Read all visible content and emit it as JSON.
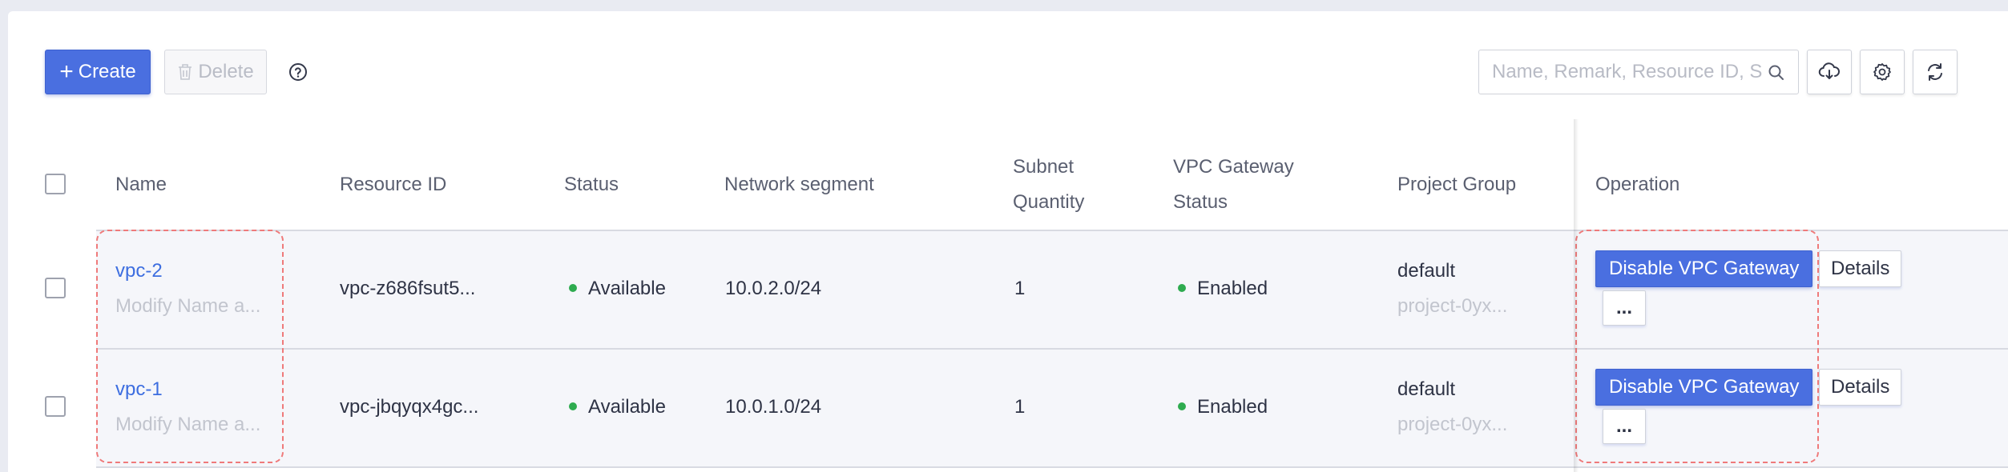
{
  "toolbar": {
    "create_label": "Create",
    "delete_label": "Delete",
    "search_placeholder": "Name, Remark, Resource ID, S"
  },
  "table": {
    "headers": {
      "name": "Name",
      "resource_id": "Resource ID",
      "status": "Status",
      "network_segment": "Network segment",
      "subnet_quantity_line1": "Subnet",
      "subnet_quantity_line2": "Quantity",
      "vpc_gateway_status_line1": "VPC Gateway",
      "vpc_gateway_status_line2": "Status",
      "project_group": "Project Group",
      "operation": "Operation"
    },
    "rows": [
      {
        "name": "vpc-2",
        "remark": "Modify Name a...",
        "resource_id": "vpc-z686fsut5...",
        "status": "Available",
        "network_segment": "10.0.2.0/24",
        "subnet_quantity": "1",
        "vpc_gateway_status": "Enabled",
        "project_group": "default",
        "project_id": "project-0yx...",
        "op_primary": "Disable VPC Gateway",
        "op_details": "Details",
        "op_more": "..."
      },
      {
        "name": "vpc-1",
        "remark": "Modify Name a...",
        "resource_id": "vpc-jbqyqx4gc...",
        "status": "Available",
        "network_segment": "10.0.1.0/24",
        "subnet_quantity": "1",
        "vpc_gateway_status": "Enabled",
        "project_group": "default",
        "project_id": "project-0yx...",
        "op_primary": "Disable VPC Gateway",
        "op_details": "Details",
        "op_more": "..."
      }
    ]
  },
  "colors": {
    "primary": "#4a6fe0",
    "link": "#3d6ee0",
    "status_green": "#2eab4f",
    "highlight_dash": "#ef7a7a"
  },
  "icons": [
    "plus-icon",
    "trash-icon",
    "help-icon",
    "search-icon",
    "cloud-download-icon",
    "gear-icon",
    "refresh-icon"
  ]
}
